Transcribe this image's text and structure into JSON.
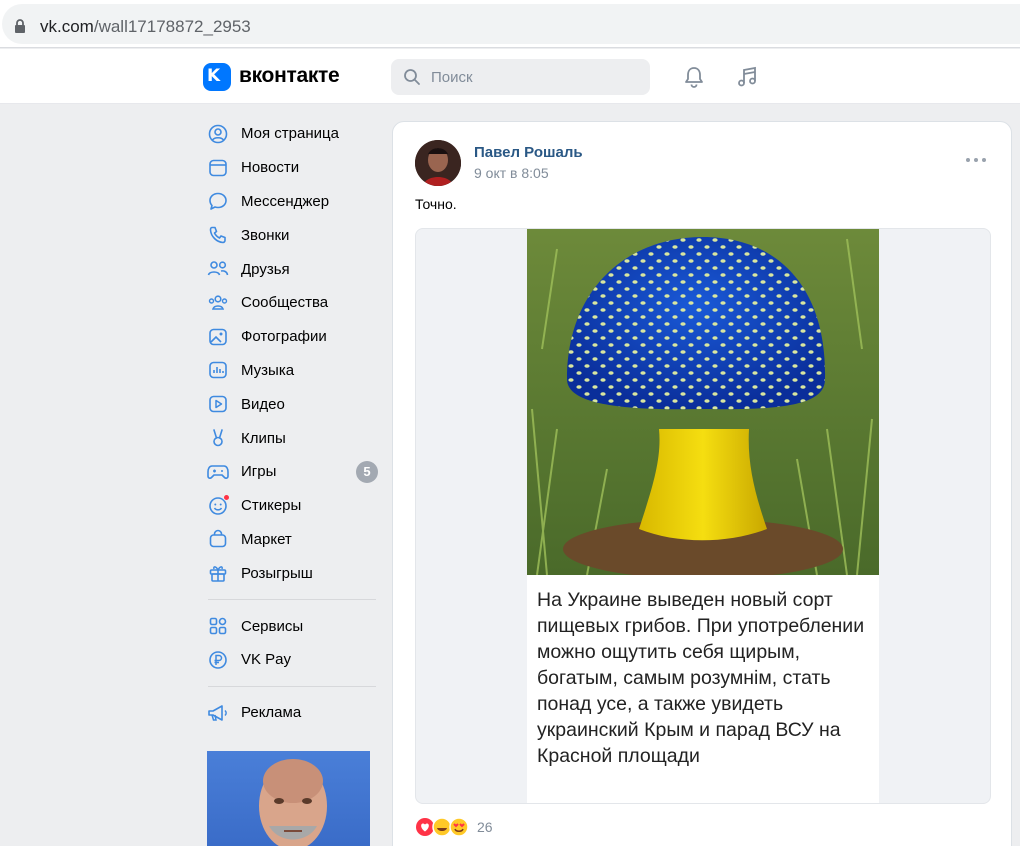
{
  "browser": {
    "url_host": "vk.com",
    "url_path": "/wall17178872_2953"
  },
  "header": {
    "logo_text": "вконтакте",
    "search_placeholder": "Поиск"
  },
  "menu": {
    "items": [
      {
        "label": "Моя страница",
        "icon": "user-circle-icon"
      },
      {
        "label": "Новости",
        "icon": "news-icon"
      },
      {
        "label": "Мессенджер",
        "icon": "message-icon"
      },
      {
        "label": "Звонки",
        "icon": "phone-icon"
      },
      {
        "label": "Друзья",
        "icon": "friends-icon"
      },
      {
        "label": "Сообщества",
        "icon": "communities-icon"
      },
      {
        "label": "Фотографии",
        "icon": "photo-icon"
      },
      {
        "label": "Музыка",
        "icon": "music-icon"
      },
      {
        "label": "Видео",
        "icon": "video-icon"
      },
      {
        "label": "Клипы",
        "icon": "clips-icon"
      },
      {
        "label": "Игры",
        "icon": "games-icon",
        "badge": "5"
      },
      {
        "label": "Стикеры",
        "icon": "stickers-icon"
      },
      {
        "label": "Маркет",
        "icon": "market-icon"
      },
      {
        "label": "Розыгрыш",
        "icon": "gift-icon"
      }
    ],
    "secondary": [
      {
        "label": "Сервисы",
        "icon": "services-icon"
      },
      {
        "label": "VK Pay",
        "icon": "vkpay-icon"
      }
    ],
    "ads": {
      "label": "Реклама",
      "icon": "megaphone-icon"
    }
  },
  "post": {
    "author": "Павел Рошаль",
    "date": "9 окт в 8:05",
    "text": "Точно.",
    "image_caption": "На Украине выведен новый сорт пищевых грибов. При употреблении можно ощутить себя щирым, богатым, самым розумнім, стать понад усе, а также увидеть украинский Крым и парад ВСУ на Красной площади",
    "reactions_count": "26"
  },
  "colors": {
    "accent": "#0077ff",
    "link": "#2a5885",
    "muted": "#818c99",
    "bg": "#edeef0"
  }
}
